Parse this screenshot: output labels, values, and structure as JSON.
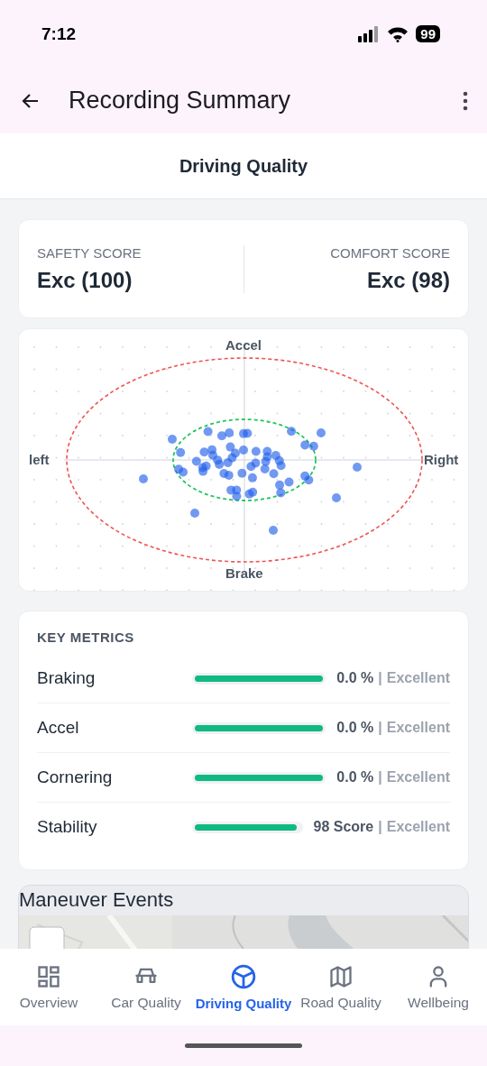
{
  "status_bar": {
    "time": "7:12",
    "battery": "99"
  },
  "app_bar": {
    "title": "Recording Summary"
  },
  "section_title": "Driving Quality",
  "scores": [
    {
      "label": "SAFETY SCORE",
      "value": "Exc (100)"
    },
    {
      "label": "COMFORT SCORE",
      "value": "Exc (98)"
    }
  ],
  "g_force_plot": {
    "top": "Accel",
    "bottom": "Brake",
    "left": "left",
    "right": "Right"
  },
  "key_metrics": {
    "title": "KEY METRICS",
    "rows": [
      {
        "name": "Braking",
        "level": 1,
        "value": "0.0 %",
        "separator": "|",
        "rating": "Excellent"
      },
      {
        "name": "Accel",
        "level": 1,
        "value": "0.0 %",
        "separator": "|",
        "rating": "Excellent"
      },
      {
        "name": "Cornering",
        "level": 1,
        "value": "0.0 %",
        "separator": "|",
        "rating": "Excellent"
      },
      {
        "name": "Stability",
        "level": 0.97,
        "value": "98 Score",
        "separator": "|",
        "rating": "Excellent"
      }
    ]
  },
  "maneuver_events": {
    "title": "Maneuver Events"
  },
  "bottom_nav": [
    {
      "label": "Overview",
      "kind": "grid",
      "selected": false
    },
    {
      "label": "Car Quality",
      "kind": "car",
      "selected": false
    },
    {
      "label": "Driving Quality",
      "kind": "wheel",
      "selected": true
    },
    {
      "label": "Road Quality",
      "kind": "map",
      "selected": false
    },
    {
      "label": "Wellbeing",
      "kind": "person",
      "selected": false
    }
  ]
}
